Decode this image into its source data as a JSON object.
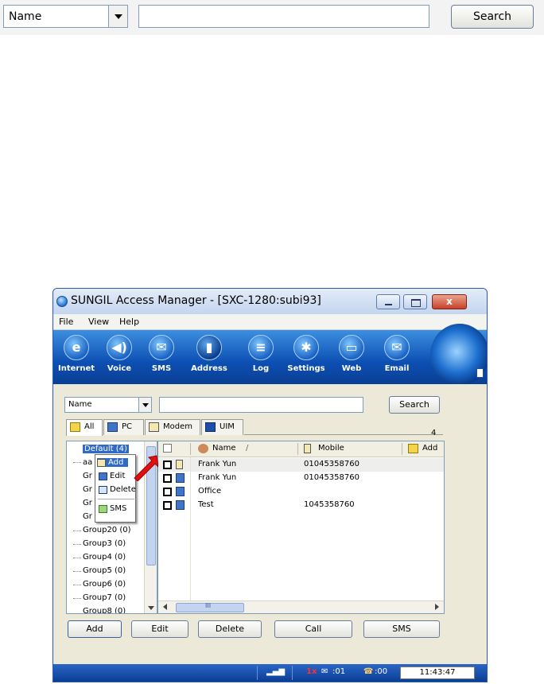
{
  "zoomed_search": {
    "field_value": "Name",
    "search_label": "Search"
  },
  "window": {
    "title": "SUNGIL Access Manager - [SXC-1280:subi93]",
    "close_glyph": "x"
  },
  "menubar": {
    "file": "File",
    "view": "View",
    "help": "Help"
  },
  "toolbar": {
    "items": [
      {
        "label": "Internet",
        "icon": "internet-icon",
        "glyph": "e"
      },
      {
        "label": "Voice",
        "icon": "voice-icon",
        "glyph": "◀)"
      },
      {
        "label": "SMS",
        "icon": "sms-icon",
        "glyph": "✉"
      },
      {
        "label": "Address",
        "icon": "address-icon",
        "glyph": "▮"
      },
      {
        "label": "Log",
        "icon": "log-icon",
        "glyph": "≡"
      },
      {
        "label": "Settings",
        "icon": "settings-icon",
        "glyph": "✱"
      },
      {
        "label": "Web",
        "icon": "web-icon",
        "glyph": "▭"
      },
      {
        "label": "Email",
        "icon": "email-icon",
        "glyph": "✉"
      }
    ],
    "active": "Address"
  },
  "search": {
    "field_value": "Name",
    "search_label": "Search"
  },
  "tabs": {
    "all": "All",
    "pc": "PC",
    "modem": "Modem",
    "uim": "UIM",
    "count": "4"
  },
  "tree": {
    "items": [
      "Default (4)",
      "aa",
      "Gr",
      "Gr",
      "Gr",
      "Gr",
      "Group20 (0)",
      "Group3 (0)",
      "Group4 (0)",
      "Group5 (0)",
      "Group6 (0)",
      "Group7 (0)",
      "Group8 (0)"
    ]
  },
  "context_menu": {
    "add": "Add",
    "edit": "Edit",
    "delete": "Delete",
    "sms": "SMS"
  },
  "list": {
    "columns": {
      "name": "Name",
      "sort_mark": "/",
      "mobile": "Mobile",
      "address": "Add"
    },
    "rows": [
      {
        "name": "Frank Yun",
        "mobile": "01045358760",
        "type": "modem"
      },
      {
        "name": "Frank Yun",
        "mobile": "01045358760",
        "type": "pc"
      },
      {
        "name": "Office",
        "mobile": "",
        "type": "pc"
      },
      {
        "name": "Test",
        "mobile": "1045358760",
        "type": "pc"
      }
    ],
    "scroll_grip": "III"
  },
  "actions": {
    "add": "Add",
    "edit": "Edit",
    "delete": "Delete",
    "call": "Call",
    "sms": "SMS"
  },
  "status": {
    "network": "1x",
    "messages": ":01",
    "calls": ":00",
    "clock": "11:43:47"
  }
}
